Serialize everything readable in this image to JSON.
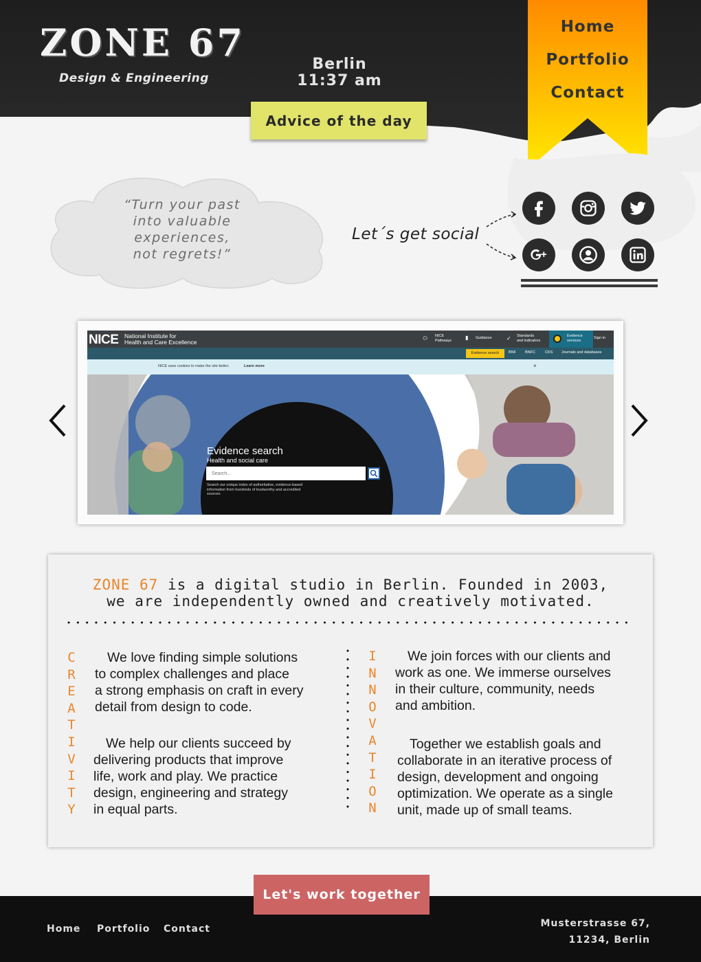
{
  "brand": {
    "logo": "ZONE 67",
    "tagline": "Design & Engineering"
  },
  "clock": {
    "city": "Berlin",
    "time": "11:37 am"
  },
  "advice_button": "Advice of the day",
  "nav": {
    "items": [
      "Home",
      "Portfolio",
      "Contact"
    ]
  },
  "quote": {
    "lines": [
      "“Turn your past",
      "into valuable",
      "experiences,",
      "not regrets!”"
    ]
  },
  "social": {
    "label": "Let´s get social",
    "icons": [
      "facebook-icon",
      "instagram-icon",
      "twitter-icon",
      "google-plus-icon",
      "profile-icon",
      "linkedin-icon"
    ]
  },
  "carousel": {
    "slide": {
      "logo": "NICE",
      "logo_sub": [
        "National Institute for",
        "Health and Care Excellence"
      ],
      "nav_items": [
        [
          "NICE",
          "Pathways"
        ],
        [
          "Guidance"
        ],
        [
          "Standards",
          "and indicators"
        ],
        [
          "Evidence",
          "services"
        ],
        [
          "Sign in"
        ]
      ],
      "tabs": [
        "Evidence search",
        "BNF",
        "BNFC",
        "CKS",
        "Journals and databases"
      ],
      "cookie_text": "NICE uses cookies to make the site better.",
      "cookie_link": "Learn more",
      "cookie_close": "×",
      "hero_title": "Evidence search",
      "hero_subtitle": "Health and social care",
      "search_placeholder": "Search...",
      "hero_desc": "Search our unique index of authoritative, evidence-based information from hundreds of trustworthy and accredited sources."
    }
  },
  "about": {
    "headline_brand": "ZONE 67",
    "headline_rest": " is a digital studio in Berlin. Founded in 2003,",
    "headline_line2": "we are independently owned and creatively motivated.",
    "left_word": "CREATIVITY",
    "right_word": "INNOVATION",
    "left_paragraphs": [
      [
        "We love finding simple solutions",
        "to complex challenges and place",
        "a strong emphasis on craft in every",
        "detail from design to code."
      ],
      [
        "We help our clients succeed by",
        "delivering products that improve",
        "life, work and play. We practice",
        "design, engineering and strategy",
        "in equal parts."
      ]
    ],
    "right_paragraphs": [
      [
        "We join forces with our clients and",
        "work as one. We immerse ourselves",
        "in their culture, community, needs",
        "and ambition."
      ],
      [
        "Together we establish goals and",
        "collaborate in an iterative process of",
        "design, development and ongoing",
        "optimization. We operate as a single",
        "unit, made up of small teams."
      ]
    ]
  },
  "cta": "Let's work together",
  "footer": {
    "nav": [
      "Home",
      "Portfolio",
      "Contact"
    ],
    "address": [
      "Musterstrasse 67,",
      "11234, Berlin"
    ]
  },
  "colors": {
    "header": "#1b1b1b",
    "accent": "#e8862a",
    "ribbon_top": "#ff8a00",
    "ribbon_bottom": "#ffe500",
    "advice": "#e2e46a",
    "cta": "#cc6464"
  }
}
